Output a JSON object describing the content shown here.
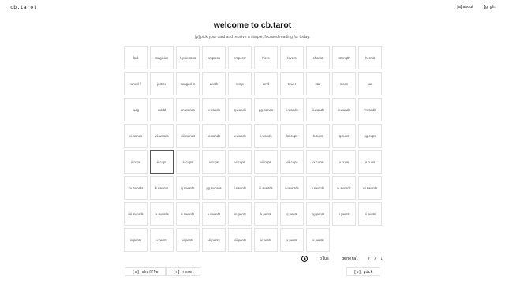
{
  "header": {
    "logo": "cb.tarot",
    "nav": [
      {
        "label": "[a] about"
      },
      {
        "label": "[g] gh."
      }
    ]
  },
  "main": {
    "title": "welcome to cb.tarot",
    "subtitle": "[p] pick your card and receive a simple, focused reading for today.",
    "selected_index": 41,
    "cards": [
      "fool",
      "magician",
      "h.priestess",
      "empress",
      "emperor",
      "hiero",
      "lovers",
      "chariot",
      "strength",
      "hermit",
      "wheel f",
      "justice",
      "hanged m",
      "death",
      "temp",
      "devil",
      "tower",
      "star",
      "moon",
      "sun",
      "judg",
      "world",
      "kn.wands",
      "k.wands",
      "q.wands",
      "pg.wands",
      "ii.wands",
      "iii.wands",
      "iv.wands",
      "v.wands",
      "vi.wands",
      "vii.wands",
      "viii.wands",
      "ix.wands",
      "x.wands",
      "ii.wands",
      "kn.cups",
      "k.cups",
      "q.cups",
      "pg.cups",
      "ii.cups",
      "iii.cups",
      "iv.cups",
      "v.cups",
      "vi.cups",
      "vii.cups",
      "viii.cups",
      "ix.cups",
      "x.cups",
      "a.cups",
      "kn.swords",
      "k.swords",
      "q.swords",
      "pg.swords",
      "ii.swords",
      "iii.swords",
      "iv.swords",
      "v.swords",
      "vi.swords",
      "vii.swords",
      "viii.swords",
      "ix.swords",
      "x.swords",
      "a.swords",
      "kn.pents",
      "k.pents",
      "q.pents",
      "pg.pents",
      "ii.pents",
      "iii.pents",
      "iv.pents",
      "v.pents",
      "vi.pents",
      "vii.pents",
      "viii.pents",
      "ix.pents",
      "x.pents",
      "a.pents"
    ]
  },
  "controls": {
    "plus": "plus",
    "general": "general",
    "arrows": "↑ / ↓"
  },
  "footer": {
    "shuffle": "[x] shuffle",
    "reset": "[r] reset",
    "pick": "[p] pick"
  }
}
